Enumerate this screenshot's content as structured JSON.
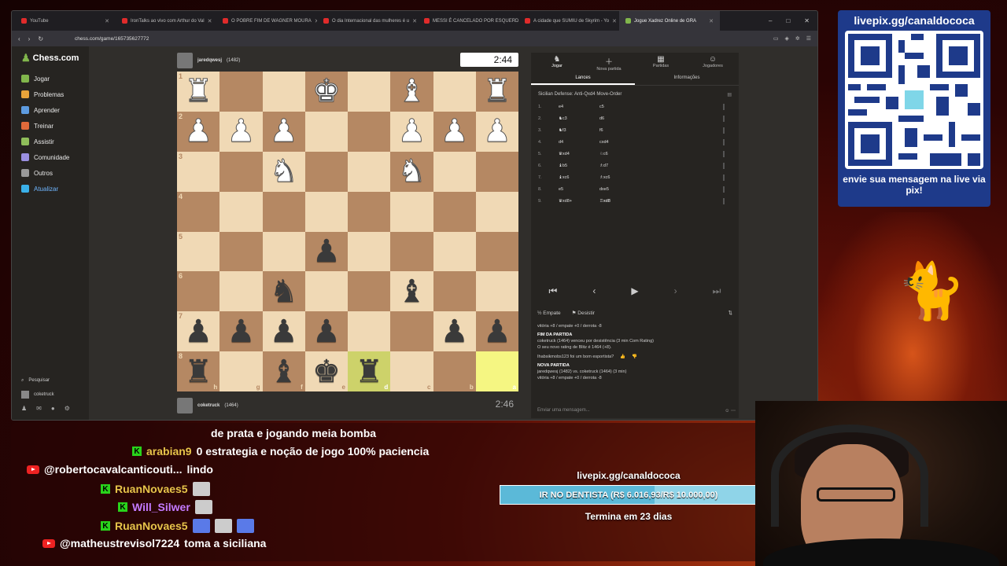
{
  "browser": {
    "tabs": [
      {
        "label": "YouTube"
      },
      {
        "label": "IronTalks ao vivo com Arthur do Val"
      },
      {
        "label": "O POBRE FIM DE WAGNER MOURA"
      },
      {
        "label": "O dia Internacional das mulheres é u"
      },
      {
        "label": "MESSI É CANCELADO POR ESQUERD"
      },
      {
        "label": "A cidade que SUMIU de Skyrim - Yo"
      },
      {
        "label": "Jogue Xadrez Online de GRA"
      }
    ],
    "url": "chess.com/game/165735627772"
  },
  "sidebar": {
    "logo": "Chess.com",
    "items": [
      {
        "label": "Jogar",
        "color": "#81b64c"
      },
      {
        "label": "Problemas",
        "color": "#e8a33a"
      },
      {
        "label": "Aprender",
        "color": "#5d9be0"
      },
      {
        "label": "Treinar",
        "color": "#e06a3a"
      },
      {
        "label": "Assistir",
        "color": "#8fbd5a"
      },
      {
        "label": "Comunidade",
        "color": "#9a8fe0"
      },
      {
        "label": "Outros",
        "color": "#999999"
      },
      {
        "label": "Atualizar",
        "color": "#3ab0e8"
      }
    ],
    "search": "Pesquisar",
    "username": "coketruck"
  },
  "top_player": {
    "name": "jaredqwesj",
    "rating": "(1482)",
    "clock": "2:44"
  },
  "bottom_player": {
    "name": "coketruck",
    "rating": "(1464)",
    "clock": "2:46"
  },
  "board": {
    "ranks": [
      "1",
      "2",
      "3",
      "4",
      "5",
      "6",
      "7",
      "8"
    ],
    "files": [
      "h",
      "g",
      "f",
      "e",
      "d",
      "c",
      "b",
      "a"
    ],
    "rows": [
      [
        "♜",
        "",
        "",
        "♚",
        "",
        "♝",
        "",
        "♜"
      ],
      [
        "♟",
        "♟",
        "♟",
        "",
        "",
        "♟",
        "♟",
        "♟"
      ],
      [
        "",
        "",
        "♞",
        "",
        "",
        "♞",
        "",
        ""
      ],
      [
        "",
        "",
        "",
        "",
        "",
        "",
        "",
        ""
      ],
      [
        "",
        "",
        "",
        "♟",
        "",
        "",
        "",
        ""
      ],
      [
        "",
        "",
        "♞",
        "",
        "",
        "♝",
        "",
        ""
      ],
      [
        "♟",
        "♟",
        "♟",
        "♟",
        "",
        "",
        "♟",
        "♟"
      ],
      [
        "♜",
        "",
        "♝",
        "♚",
        "♜",
        "",
        "",
        ""
      ]
    ],
    "colors": [
      [
        "w",
        "",
        "",
        "w",
        "",
        "w",
        "",
        "w"
      ],
      [
        "w",
        "w",
        "w",
        "",
        "",
        "w",
        "w",
        "w"
      ],
      [
        "",
        "",
        "w",
        "",
        "",
        "w",
        "",
        ""
      ],
      [
        "",
        "",
        "",
        "",
        "",
        "",
        "",
        ""
      ],
      [
        "",
        "",
        "",
        "b",
        "",
        "",
        "",
        ""
      ],
      [
        "",
        "",
        "b",
        "",
        "",
        "b",
        "",
        ""
      ],
      [
        "b",
        "b",
        "b",
        "b",
        "",
        "",
        "b",
        "b"
      ],
      [
        "b",
        "",
        "b",
        "b",
        "b",
        "",
        "",
        ""
      ]
    ],
    "highlight": [
      [
        7,
        4
      ],
      [
        7,
        7
      ]
    ]
  },
  "panel": {
    "tabs": [
      {
        "label": "Jogar",
        "icon": "♞"
      },
      {
        "label": "Nova partida",
        "icon": "＋"
      },
      {
        "label": "Partidas",
        "icon": "▦"
      },
      {
        "label": "Jogadores",
        "icon": "☺"
      }
    ],
    "subtabs": [
      "Lances",
      "Informações"
    ],
    "opening": "Sicilian Defense: Anti-Qxd4 Move-Order",
    "moves": [
      {
        "n": "1.",
        "w": "e4",
        "b": "c5"
      },
      {
        "n": "2.",
        "w": "♞c3",
        "b": "d6"
      },
      {
        "n": "3.",
        "w": "♞f3",
        "b": "f6"
      },
      {
        "n": "4.",
        "w": "d4",
        "b": "cxd4"
      },
      {
        "n": "5.",
        "w": "♛xd4",
        "b": "♘c6"
      },
      {
        "n": "6.",
        "w": "♝b5",
        "b": "♗d7"
      },
      {
        "n": "7.",
        "w": "♝xc6",
        "b": "♗xc6"
      },
      {
        "n": "8.",
        "w": "e5",
        "b": "dxe5"
      },
      {
        "n": "9.",
        "w": "♛xd8+",
        "b": "♖xd8"
      }
    ],
    "actions": {
      "draw": "Empate",
      "resign": "Desistir"
    },
    "chat": {
      "line1": "vitória +8 / empate +0 / derrota -8",
      "end_title": "FIM DA PARTIDA",
      "end_line": "coketruck (1464) venceu por desistência (3 min Com Rating)",
      "new_rating": "O seu novo rating de Blitz é 1464 (+8).",
      "question": "Ihabsikmobs123 foi um bom esportista?",
      "new_title": "NOVA PARTIDA",
      "new_line": "jaredqwesj (1482) vs. coketruck (1464) (3 min)",
      "line2": "vitória +8 / empate +0 / derrota -8"
    },
    "input_placeholder": "Enviar uma mensagem..."
  },
  "qr": {
    "title": "livepix.gg/canaldococa",
    "caption": "envie sua mensagem na live via pix!"
  },
  "stream_chat": [
    {
      "platform": "",
      "user": "",
      "msg": "de prata e jogando meia bomba"
    },
    {
      "platform": "kick",
      "user": "arabian9",
      "msg": "0 estrategia e noção de jogo 100% paciencia",
      "color": "#ffffff"
    },
    {
      "platform": "youtube",
      "user": "@robertocavalcanticouti...",
      "msg": "lindo",
      "color": "#ffffff"
    },
    {
      "platform": "kick",
      "user": "RuanNovaes5",
      "msg": "",
      "color": "#e6c44a"
    },
    {
      "platform": "kick",
      "user": "Will_Silwer",
      "msg": "",
      "color": "#c47aff"
    },
    {
      "platform": "kick",
      "user": "RuanNovaes5",
      "msg": "",
      "color": "#e6c44a"
    },
    {
      "platform": "youtube",
      "user": "@matheustrevisol7224",
      "msg": "toma a siciliana",
      "color": "#ffffff"
    }
  ],
  "goal": {
    "title": "livepix.gg/canaldococa",
    "bar_text": "IR NO DENTISTA (R$ 6.016,93/R$ 10.000,00)",
    "progress": 0.6017,
    "ends": "Termina em 23 dias"
  }
}
